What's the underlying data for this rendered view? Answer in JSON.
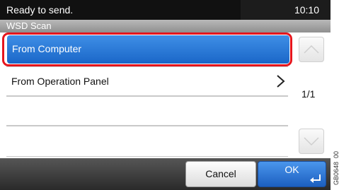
{
  "status_bar": {
    "message": "Ready to send.",
    "time": "10:10"
  },
  "title_bar": {
    "title": "WSD Scan"
  },
  "list": {
    "items": [
      {
        "label": "From Computer",
        "selected": true
      },
      {
        "label": "From Operation Panel",
        "selected": false,
        "has_chevron": true
      },
      {
        "label": ""
      },
      {
        "label": ""
      }
    ]
  },
  "pager": {
    "indicator": "1/1"
  },
  "buttons": {
    "cancel": "Cancel",
    "ok": "OK"
  },
  "figure_code": "GB0648_00",
  "colors": {
    "selected": "#2a7bdc",
    "highlight_ring": "#e5151d",
    "ok_button": "#2a7bdc"
  },
  "icons": {
    "scroll_up": "chevron-up-icon",
    "scroll_down": "chevron-down-icon",
    "row_next": "chevron-right-icon",
    "ok_enter": "enter-icon"
  }
}
